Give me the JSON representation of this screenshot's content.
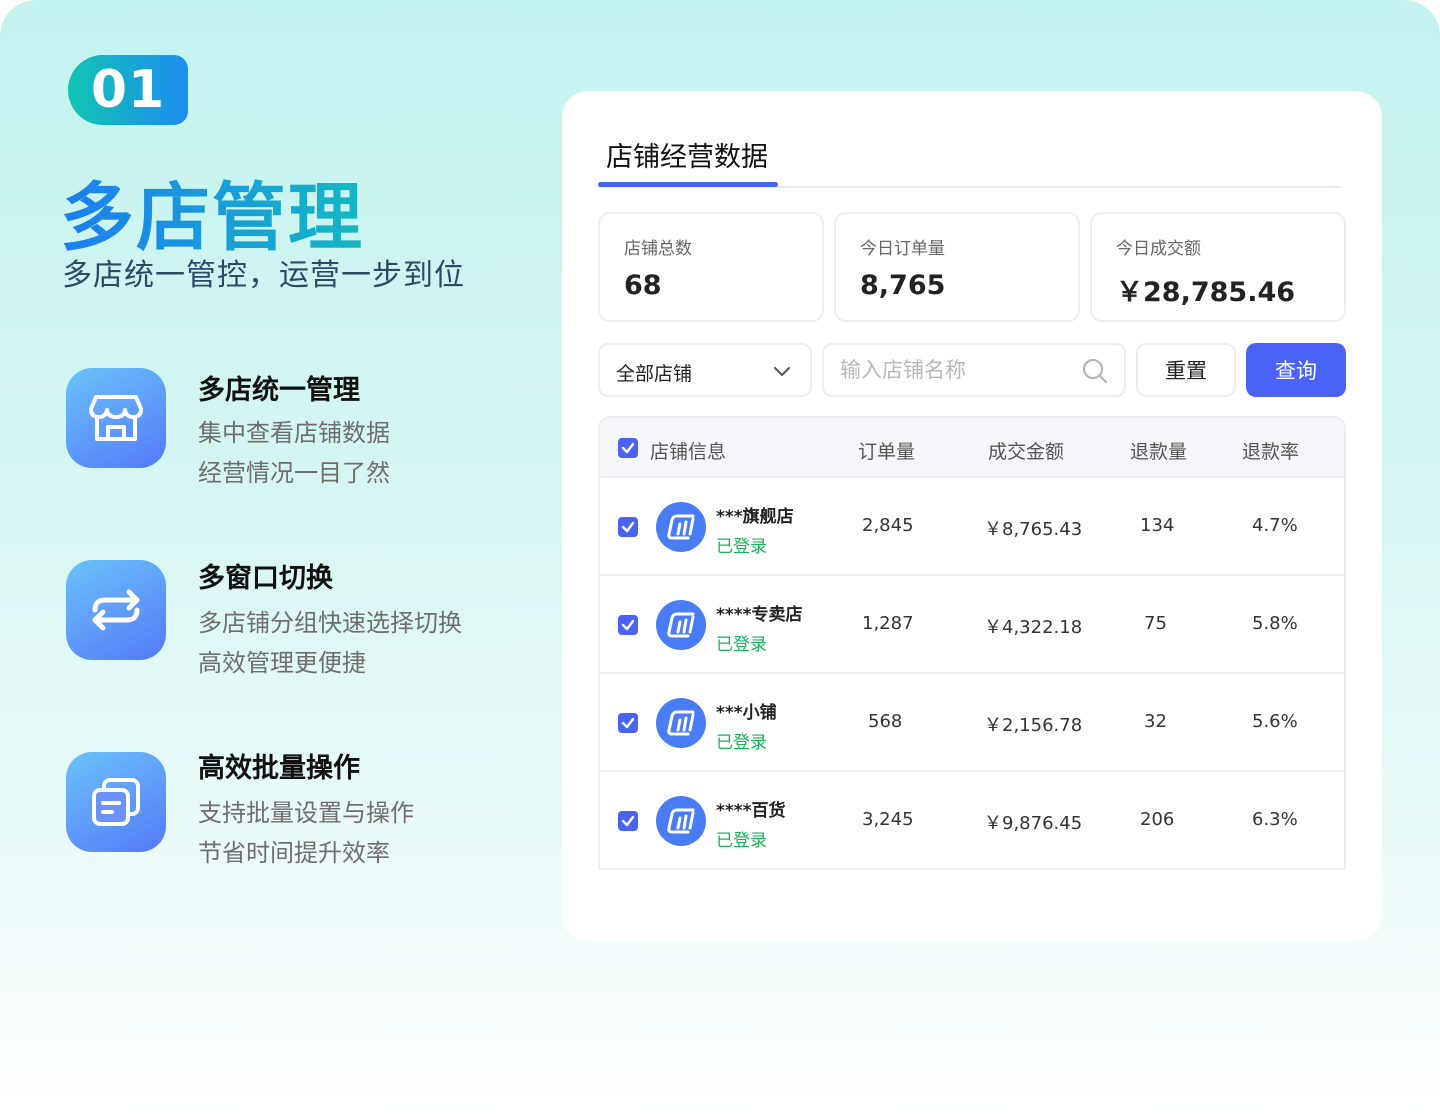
{
  "badge": "01",
  "title": "多店管理",
  "subtitle": "多店统一管控，运营一步到位",
  "features": [
    {
      "icon": "store-icon",
      "title": "多店统一管理",
      "lines": [
        "集中查看店铺数据",
        "经营情况一目了然"
      ]
    },
    {
      "icon": "switch-icon",
      "title": "多窗口切换",
      "lines": [
        "多店铺分组快速选择切换",
        "高效管理更便捷"
      ]
    },
    {
      "icon": "batch-icon",
      "title": "高效批量操作",
      "lines": [
        "支持批量设置与操作",
        "节省时间提升效率"
      ]
    }
  ],
  "card": {
    "tab": "店铺经营数据",
    "stats": [
      {
        "label": "店铺总数",
        "value": "68"
      },
      {
        "label": "今日订单量",
        "value": "8,765"
      },
      {
        "label": "今日成交额",
        "value": "￥28,785.46"
      }
    ],
    "filter": {
      "select_value": "全部店铺",
      "search_placeholder": "输入店铺名称",
      "reset_label": "重置",
      "query_label": "查询"
    },
    "table": {
      "headers": [
        "店铺信息",
        "订单量",
        "成交金额",
        "退款量",
        "退款率"
      ],
      "rows": [
        {
          "name": "***旗舰店",
          "status": "已登录",
          "orders": "2,845",
          "amount": "￥8,765.43",
          "refunds": "134",
          "rate": "4.7%"
        },
        {
          "name": "****专卖店",
          "status": "已登录",
          "orders": "1,287",
          "amount": "￥4,322.18",
          "refunds": "75",
          "rate": "5.8%"
        },
        {
          "name": "***小铺",
          "status": "已登录",
          "orders": "568",
          "amount": "￥2,156.78",
          "refunds": "32",
          "rate": "5.6%"
        },
        {
          "name": "****百货",
          "status": "已登录",
          "orders": "3,245",
          "amount": "￥9,876.45",
          "refunds": "206",
          "rate": "6.3%"
        }
      ]
    }
  },
  "colors": {
    "accent": "#4a63f5",
    "status_green": "#19b15c",
    "brand_teal": "#14b8c4"
  }
}
